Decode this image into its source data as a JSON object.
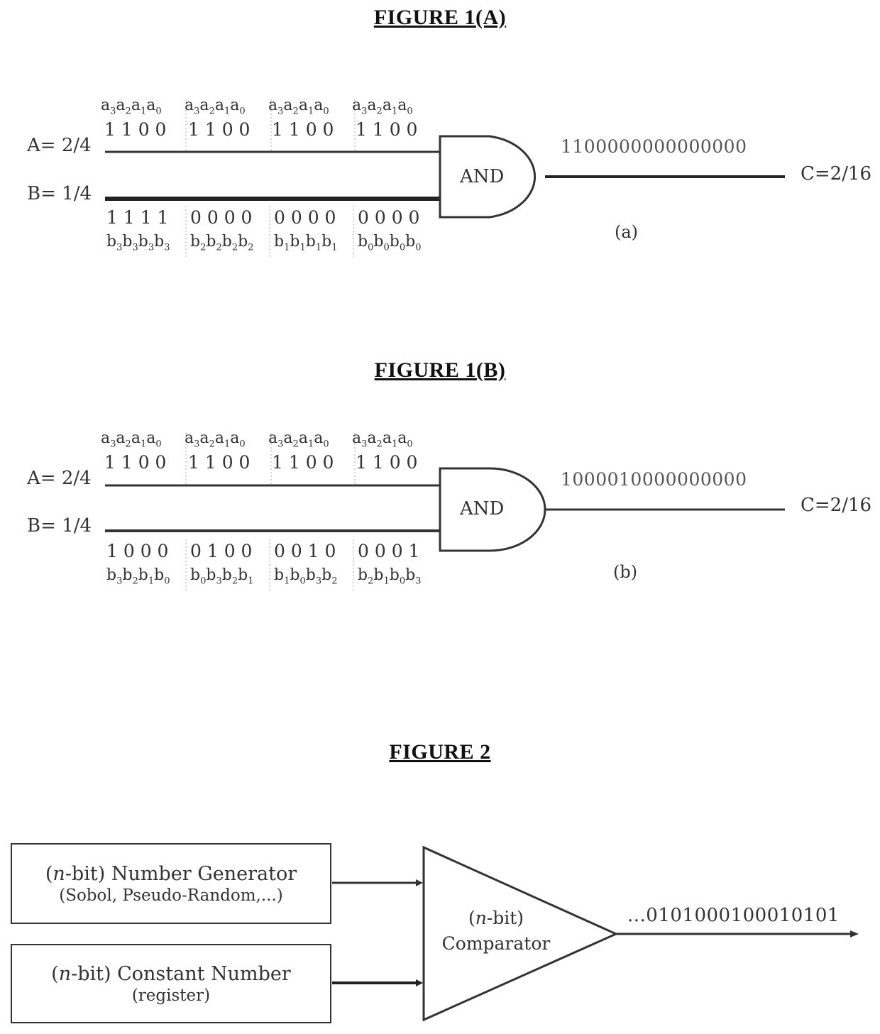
{
  "figure_1a": {
    "title": "FIGURE 1(A)",
    "input_a_label": "A= 2/4",
    "input_b_label": "B= 1/4",
    "a_subscript_groups": [
      [
        "3",
        "2",
        "1",
        "0"
      ],
      [
        "3",
        "2",
        "1",
        "0"
      ],
      [
        "3",
        "2",
        "1",
        "0"
      ],
      [
        "3",
        "2",
        "1",
        "0"
      ]
    ],
    "a_bit_groups": [
      "1 1 0 0",
      "1 1 0 0",
      "1 1 0 0",
      "1 1 0 0"
    ],
    "b_bit_groups": [
      "1 1 1 1",
      "0 0 0 0",
      "0 0 0 0",
      "0 0 0 0"
    ],
    "b_subscript_groups": [
      [
        "3",
        "3",
        "3",
        "3"
      ],
      [
        "2",
        "2",
        "2",
        "2"
      ],
      [
        "1",
        "1",
        "1",
        "1"
      ],
      [
        "0",
        "0",
        "0",
        "0"
      ]
    ],
    "gate_label": "AND",
    "output_stream": "1100000000000000",
    "output_label": "C=2/16",
    "caption": "(a)"
  },
  "figure_1b": {
    "title": "FIGURE 1(B)",
    "input_a_label": "A= 2/4",
    "input_b_label": "B= 1/4",
    "a_subscript_groups": [
      [
        "3",
        "2",
        "1",
        "0"
      ],
      [
        "3",
        "2",
        "1",
        "0"
      ],
      [
        "3",
        "2",
        "1",
        "0"
      ],
      [
        "3",
        "2",
        "1",
        "0"
      ]
    ],
    "a_bit_groups": [
      "1 1 0 0",
      "1 1 0 0",
      "1 1 0 0",
      "1 1 0 0"
    ],
    "b_bit_groups": [
      "1 0 0 0",
      "0 1 0 0",
      "0 0 1 0",
      "0 0 0 1"
    ],
    "b_subscript_groups": [
      [
        "3",
        "2",
        "1",
        "0"
      ],
      [
        "0",
        "3",
        "2",
        "1"
      ],
      [
        "1",
        "0",
        "3",
        "2"
      ],
      [
        "2",
        "1",
        "0",
        "3"
      ]
    ],
    "gate_label": "AND",
    "output_stream": "1000010000000000",
    "output_label": "C=2/16",
    "caption": "(b)"
  },
  "figure_2": {
    "title": "FIGURE 2",
    "generator_box": {
      "line1_prefix": "(",
      "line1_var": "n",
      "line1_suffix": "-bit) Number Generator",
      "line2": "(Sobol, Pseudo-Random,...)"
    },
    "constant_box": {
      "line1_prefix": "(",
      "line1_var": "n",
      "line1_suffix": "-bit) Constant Number",
      "line2": "(register)"
    },
    "comparator": {
      "line1_prefix": "(",
      "line1_var": "n",
      "line1_suffix": "-bit)",
      "line2": "Comparator"
    },
    "output_stream": "...0101000100010101"
  }
}
